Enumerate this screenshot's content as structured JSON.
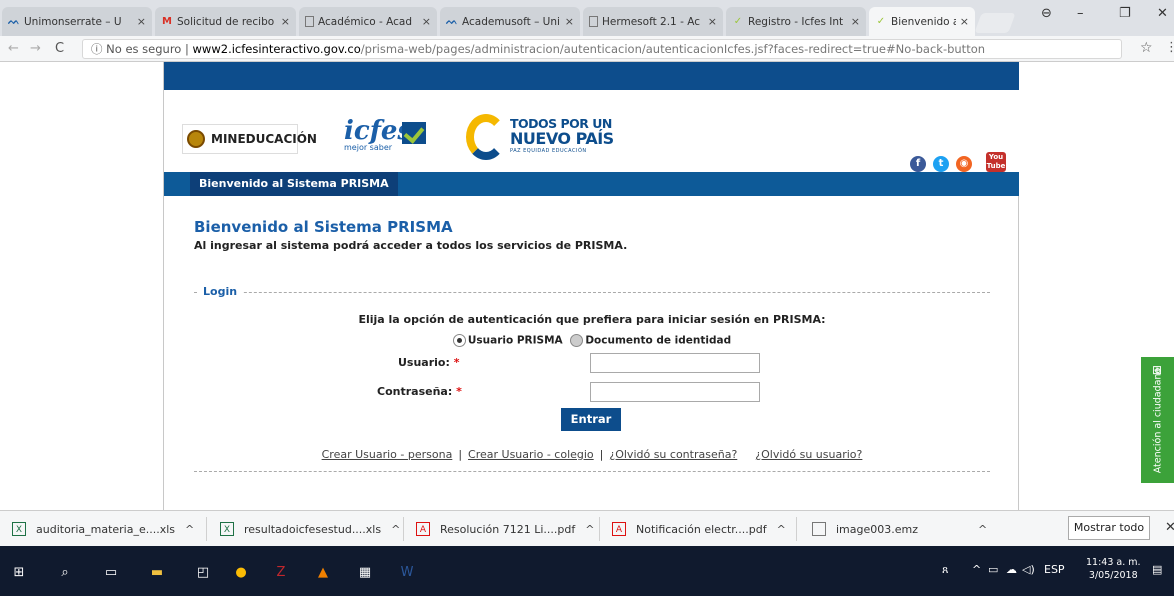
{
  "browser": {
    "tabs": [
      {
        "label": "Unimonserrate – U",
        "icon": "academusoft-icon"
      },
      {
        "label": "Solicitud de recibo",
        "icon": "gmail-icon"
      },
      {
        "label": "Académico - Acad",
        "icon": "page-icon"
      },
      {
        "label": "Academusoft – Uni",
        "icon": "academusoft-icon"
      },
      {
        "label": "Hermesoft 2.1 - Ac",
        "icon": "page-icon"
      },
      {
        "label": "Registro - Icfes Int",
        "icon": "icfes-icon"
      },
      {
        "label": "Bienvenido al Siste",
        "icon": "icfes-icon"
      }
    ],
    "tab_close": "×",
    "security_label": "No es seguro",
    "url_domain": "www2.icfesinteractivo.gov.co",
    "url_path": "/prisma-web/pages/administracion/autenticacion/autenticacionIcfes.jsf?faces-redirect=true#No-back-button"
  },
  "header": {
    "logo_mineducacion": "MINEDUCACIÓN",
    "logo_icfes": "icfes",
    "logo_icfes_sub": "mejor saber",
    "logo_tpnp_line1": "TODOS POR UN",
    "logo_tpnp_line2": "NUEVO PAÍS",
    "logo_tpnp_line3": "PAZ  EQUIDAD  EDUCACIÓN",
    "social": [
      {
        "name": "facebook-icon",
        "glyph": "f",
        "color": "#3b5998"
      },
      {
        "name": "twitter-icon",
        "glyph": "t",
        "color": "#1da1f2"
      },
      {
        "name": "rss-icon",
        "glyph": "◉",
        "color": "#f26522"
      }
    ],
    "youtube_top": "You",
    "youtube_bottom": "Tube"
  },
  "nav": {
    "tab_label": "Bienvenido al Sistema PRISMA"
  },
  "main": {
    "title": "Bienvenido al Sistema PRISMA",
    "subtitle": "Al ingresar al sistema podrá acceder a todos los servicios de PRISMA.",
    "login_legend": "Login",
    "auth_prompt": "Elija la opción de autenticación que prefiera para iniciar sesión en PRISMA:",
    "radio_usuario": "Usuario PRISMA",
    "radio_documento": "Documento de identidad",
    "usuario_label": "Usuario:",
    "password_label": "Contraseña:",
    "required_mark": "*",
    "usuario_value": "",
    "password_value": "",
    "submit_label": "Entrar",
    "links": {
      "crear_persona": "Crear Usuario - persona",
      "crear_colegio": "Crear Usuario - colegio",
      "olvido_contrasena": "¿Olvidó su contraseña?",
      "olvido_usuario": "¿Olvidó su usuario?",
      "separator": "|"
    }
  },
  "side_tab": {
    "label": "Atención al ciudadano"
  },
  "downloads": {
    "items": [
      {
        "name": "auditoria_materia_e....xls",
        "type": "xls"
      },
      {
        "name": "resultadoicfesestud....xls",
        "type": "xls"
      },
      {
        "name": "Resolución 7121 Li....pdf",
        "type": "pdf"
      },
      {
        "name": "Notificación electr....pdf",
        "type": "pdf"
      },
      {
        "name": "image003.emz",
        "type": "file"
      }
    ],
    "show_all": "Mostrar todo"
  },
  "taskbar": {
    "lang": "ESP",
    "time": "11:43 a. m.",
    "date": "3/05/2018"
  }
}
